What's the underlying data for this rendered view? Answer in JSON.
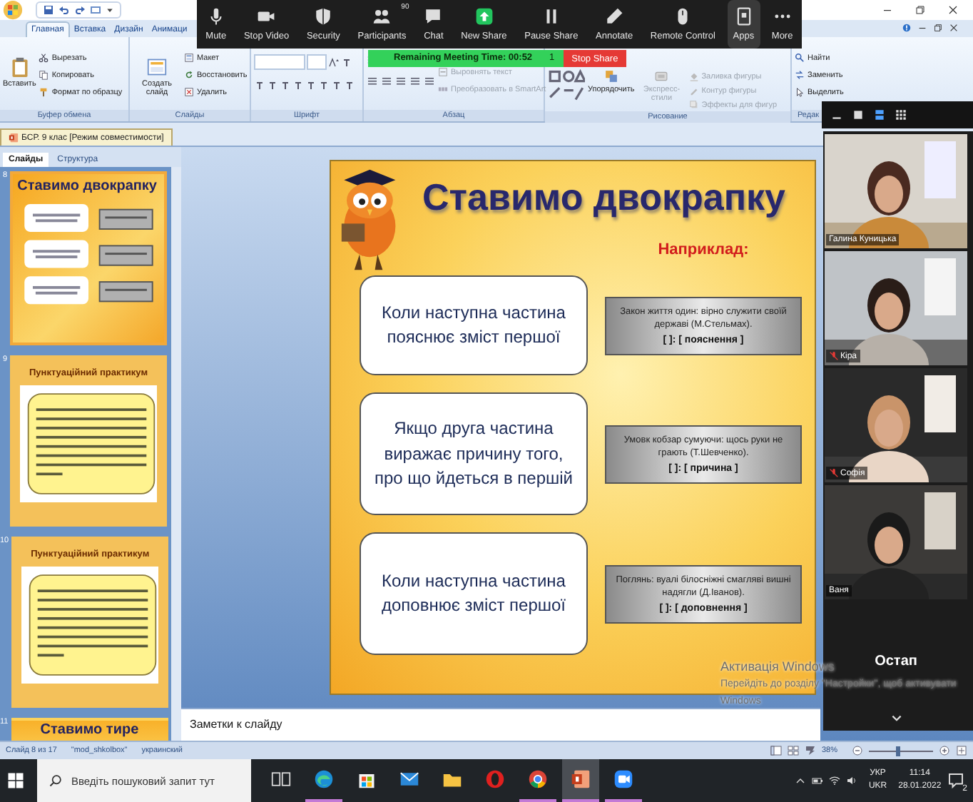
{
  "ppt": {
    "tabs": [
      {
        "label": "Главная",
        "selected": true
      },
      {
        "label": "Вставка",
        "selected": false
      },
      {
        "label": "Дизайн",
        "selected": false
      },
      {
        "label": "Анимаци",
        "selected": false
      }
    ],
    "groups": [
      {
        "kind": "clipboard",
        "label": "Буфер обмена",
        "big": [
          {
            "label": "Вставить",
            "disabled": false
          }
        ],
        "items": [
          {
            "label": "Вырезать",
            "disabled": false
          },
          {
            "label": "Копировать",
            "disabled": false
          },
          {
            "label": "Формат по образцу",
            "disabled": false
          }
        ]
      },
      {
        "kind": "slides",
        "label": "Слайды",
        "big": [
          {
            "label": "Создать слайд",
            "disabled": false
          }
        ],
        "items": [
          {
            "label": "Макет",
            "disabled": false
          },
          {
            "label": "Восстановить",
            "disabled": false
          },
          {
            "label": "Удалить",
            "disabled": false
          }
        ]
      },
      {
        "kind": "font",
        "label": "Шрифт"
      },
      {
        "kind": "paragraph",
        "label": "Абзац",
        "items": [
          {
            "label": "Выровнять текст",
            "disabled": true
          },
          {
            "label": "Преобразовать в SmartArt",
            "disabled": true
          }
        ]
      },
      {
        "kind": "drawing",
        "label": "Рисование",
        "big": [
          {
            "label": "Упорядочить",
            "disabled": false
          },
          {
            "label": "Экспресс-стили",
            "disabled": true
          }
        ],
        "items": [
          {
            "label": "Заливка фигуры",
            "disabled": true
          },
          {
            "label": "Контур фигуры",
            "disabled": true
          },
          {
            "label": "Эффекты для фигур",
            "disabled": true
          }
        ]
      },
      {
        "kind": "editing",
        "label": "Редак",
        "items": [
          {
            "label": "Найти",
            "disabled": false
          },
          {
            "label": "Заменить",
            "disabled": false
          },
          {
            "label": "Выделить",
            "disabled": false
          }
        ]
      }
    ],
    "document_tab": "БСР. 9 клас [Режим совместимости]",
    "pane_tabs": [
      {
        "label": "Слайды",
        "selected": true
      },
      {
        "label": "Структура",
        "selected": false
      }
    ],
    "thumbnails": [
      {
        "number": "8",
        "kind": "colon",
        "title": "Ставимо двокрапку",
        "selected": true
      },
      {
        "number": "9",
        "kind": "practice",
        "title": "Пунктуаційний практикум",
        "selected": false
      },
      {
        "number": "10",
        "kind": "practice",
        "title": "Пунктуаційний практикум",
        "selected": false
      },
      {
        "number": "11",
        "kind": "dash",
        "title": "Ставимо тире",
        "selected": false
      }
    ],
    "slide": {
      "title": "Ставимо двокрапку",
      "example_label": "Наприклад:",
      "rows": [
        {
          "rule": "Коли наступна частина\nпояснює зміст першої",
          "example": "Закон життя один: вірно служити своїй державі (М.Стельмах).",
          "scheme": "[ ]: [ пояснення ]"
        },
        {
          "rule": "Якщо друга частина\nвиражає причину того,\nпро що йдеться в першій",
          "example": "Умовк кобзар сумуючи: щось руки не грають (Т.Шевченко).",
          "scheme": "[ ]: [ причина ]"
        },
        {
          "rule": "Коли наступна частина\nдоповнює зміст першої",
          "example": "Поглянь: вуалі білосніжні смагляві вишні надягли (Д.Іванов).",
          "scheme": "[ ]: [ доповнення ]"
        }
      ]
    },
    "notes": {
      "placeholder": "Заметки к слайду"
    },
    "status_bar": {
      "items": [
        "Слайд 8 из 17",
        "\"mod_shkolbox\"",
        "украинский"
      ],
      "zoom": "38%",
      "level": 0.45
    }
  },
  "zoom": {
    "toolbar": [
      {
        "kind": "mic",
        "label": "Mute",
        "selected": false
      },
      {
        "kind": "video",
        "label": "Stop Video",
        "selected": false
      },
      {
        "kind": "shield",
        "label": "Security",
        "selected": false
      },
      {
        "kind": "people",
        "label": "Participants",
        "badge": "90",
        "selected": false
      },
      {
        "kind": "chat",
        "label": "Chat",
        "selected": false
      },
      {
        "kind": "share",
        "label": "New Share",
        "selected": false
      },
      {
        "kind": "pause",
        "label": "Pause Share",
        "selected": false
      },
      {
        "kind": "pen",
        "label": "Annotate",
        "selected": false
      },
      {
        "kind": "remote",
        "label": "Remote Control",
        "selected": false
      },
      {
        "kind": "apps",
        "label": "Apps",
        "selected": true
      },
      {
        "kind": "more",
        "label": "More",
        "selected": false
      }
    ],
    "timer": "Remaining Meeting Time: 00:52",
    "timer_badge": "1",
    "stop_share": "Stop Share",
    "views": [
      {
        "kind": "minimize",
        "selected": false
      },
      {
        "kind": "single",
        "selected": false
      },
      {
        "kind": "speaker",
        "selected": true
      },
      {
        "kind": "gallery",
        "selected": false
      }
    ],
    "participants": [
      {
        "name": "Галина Куницька",
        "muted": false
      },
      {
        "name": "Кіра",
        "muted": true
      },
      {
        "name": "Софія",
        "muted": true
      },
      {
        "name": "Ваня",
        "muted": false
      }
    ],
    "camera_off": {
      "name": "Остап"
    }
  },
  "os_notice": [
    "Активація Windows",
    "Перейдіть до розділу \"Настройки\", щоб активувати",
    "Windows"
  ],
  "taskbar": {
    "search": {
      "placeholder": "Введіть пошуковий запит тут"
    },
    "apps": [
      {
        "kind": "taskview",
        "running": false,
        "selected": false
      },
      {
        "kind": "edge",
        "running": true,
        "selected": false
      },
      {
        "kind": "store",
        "running": false,
        "selected": false
      },
      {
        "kind": "mail",
        "running": false,
        "selected": false
      },
      {
        "kind": "folder",
        "running": false,
        "selected": false
      },
      {
        "kind": "opera",
        "running": false,
        "selected": false
      },
      {
        "kind": "chrome",
        "running": true,
        "selected": false
      },
      {
        "kind": "powerpoint",
        "running": true,
        "selected": true
      },
      {
        "kind": "zoomapp",
        "running": true,
        "selected": false
      }
    ],
    "language": [
      "УКР",
      "UKR"
    ],
    "time": "11:14",
    "date": "28.01.2022",
    "notifications": "2"
  }
}
